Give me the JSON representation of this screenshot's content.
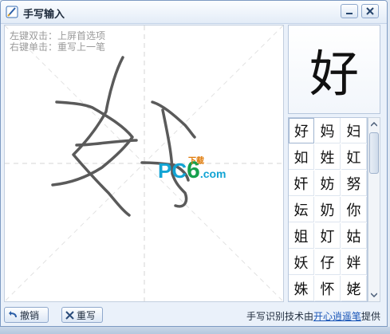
{
  "window": {
    "title": "手写输入",
    "minimize_symbol": "—",
    "close_symbol": "✕"
  },
  "canvas": {
    "hint_line1": "左键双击：上屏首选项",
    "hint_line2": "右键单击：重写上一笔",
    "watermark": {
      "pc": "PC",
      "six": "6",
      "download": "下载",
      "com": ".com"
    }
  },
  "preview": {
    "character": "好"
  },
  "candidates": [
    [
      "好",
      "妈",
      "妇"
    ],
    [
      "如",
      "姓",
      "妅"
    ],
    [
      "奸",
      "妨",
      "努"
    ],
    [
      "妘",
      "奶",
      "你"
    ],
    [
      "姐",
      "奵",
      "姑"
    ],
    [
      "妖",
      "仔",
      "姅"
    ],
    [
      "姝",
      "怀",
      "姥"
    ]
  ],
  "bottom": {
    "undo_label": "撤销",
    "rewrite_label": "重写",
    "credit_prefix": "手写识别技术由",
    "credit_link": "开心逍遥笔",
    "credit_suffix": "提供"
  },
  "colors": {
    "accent": "#1a56b8",
    "stroke": "#5a5a5a",
    "hint": "#9a9a9a"
  }
}
